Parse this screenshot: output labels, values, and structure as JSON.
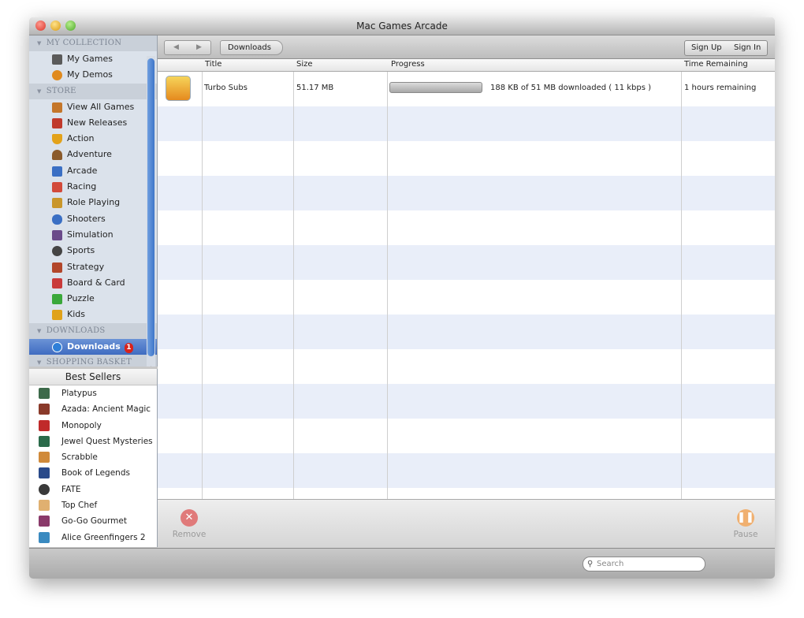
{
  "window": {
    "title": "Mac Games Arcade"
  },
  "sidebar": {
    "sections": [
      {
        "label": "MY COLLECTION",
        "items": [
          {
            "label": "My Games",
            "icon": "joystick-icon",
            "color": "#5a5a5a"
          },
          {
            "label": "My Demos",
            "icon": "demo-icon",
            "color": "#e08a1e"
          }
        ]
      },
      {
        "label": "STORE",
        "items": [
          {
            "label": "View All Games",
            "icon": "store-icon",
            "color": "#c4762a"
          },
          {
            "label": "New Releases",
            "icon": "gift-icon",
            "color": "#c0392b"
          },
          {
            "label": "Action",
            "icon": "shield-icon",
            "color": "#e3a21a"
          },
          {
            "label": "Adventure",
            "icon": "hat-icon",
            "color": "#8a5a2b"
          },
          {
            "label": "Arcade",
            "icon": "arcade-icon",
            "color": "#3a6fc4"
          },
          {
            "label": "Racing",
            "icon": "flag-icon",
            "color": "#d24a3a"
          },
          {
            "label": "Role Playing",
            "icon": "castle-icon",
            "color": "#c9962a"
          },
          {
            "label": "Shooters",
            "icon": "bullet-icon",
            "color": "#3a6fc4"
          },
          {
            "label": "Simulation",
            "icon": "joystick-icon",
            "color": "#6a4a8a"
          },
          {
            "label": "Sports",
            "icon": "ball-icon",
            "color": "#444444"
          },
          {
            "label": "Strategy",
            "icon": "strategy-icon",
            "color": "#b2462a"
          },
          {
            "label": "Board & Card",
            "icon": "cards-icon",
            "color": "#c93a3a"
          },
          {
            "label": "Puzzle",
            "icon": "puzzle-icon",
            "color": "#3aa83a"
          },
          {
            "label": "Kids",
            "icon": "kids-icon",
            "color": "#e0a21a"
          }
        ]
      },
      {
        "label": "DOWNLOADS",
        "items": [
          {
            "label": "Downloads",
            "icon": "download-icon",
            "color": "#2f7fd8",
            "badge": "1"
          }
        ]
      },
      {
        "label": "SHOPPING BASKET",
        "items": []
      }
    ]
  },
  "bestsellers": {
    "title": "Best Sellers",
    "items": [
      {
        "label": "Platypus",
        "color": "#3d6a4a"
      },
      {
        "label": "Azada: Ancient Magic",
        "color": "#8a3a2a"
      },
      {
        "label": "Monopoly",
        "color": "#c02a2a"
      },
      {
        "label": "Jewel Quest Mysteries",
        "color": "#2a6a4a"
      },
      {
        "label": "Scrabble",
        "color": "#d08a3a"
      },
      {
        "label": "Book of Legends",
        "color": "#2a4a8a"
      },
      {
        "label": "FATE",
        "color": "#3a3a3a"
      },
      {
        "label": "Top Chef",
        "color": "#e0b070"
      },
      {
        "label": "Go-Go Gourmet",
        "color": "#8a3a6a"
      },
      {
        "label": "Alice Greenfingers 2",
        "color": "#3a8ac0"
      }
    ]
  },
  "toolbar": {
    "back": "◀",
    "forward": "▶",
    "breadcrumb": "Downloads",
    "signup": "Sign Up",
    "signin": "Sign In"
  },
  "table": {
    "columns": [
      "Title",
      "Size",
      "Progress",
      "Time Remaining"
    ],
    "rows": [
      {
        "title": "Turbo Subs",
        "size": "51.17 MB",
        "progress_text": "188 KB of 51 MB downloaded ( 11 kbps )",
        "progress_fraction": 0.0036,
        "time_remaining": "1 hours remaining"
      }
    ]
  },
  "actions": {
    "remove": "Remove",
    "pause": "Pause"
  },
  "search": {
    "placeholder": "Search"
  }
}
